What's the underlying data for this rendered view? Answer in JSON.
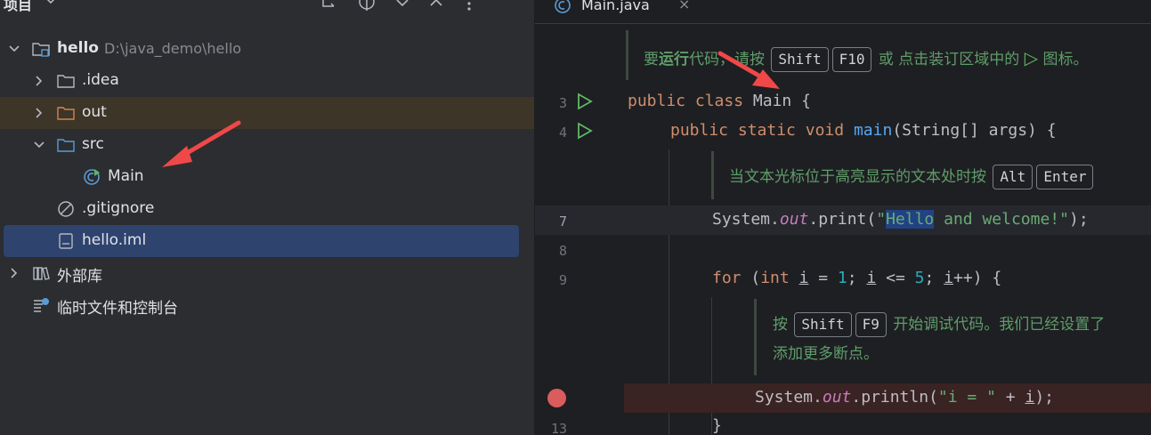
{
  "project": {
    "title": "项目",
    "tree": [
      {
        "label": "hello",
        "path": "D:\\java_demo\\hello"
      },
      {
        "label": ".idea"
      },
      {
        "label": "out"
      },
      {
        "label": "src"
      },
      {
        "label": "Main"
      },
      {
        "label": ".gitignore"
      },
      {
        "label": "hello.iml"
      },
      {
        "label": "外部库"
      },
      {
        "label": "临时文件和控制台"
      }
    ]
  },
  "editor": {
    "tab_label": "Main.java",
    "tab_close": "×",
    "line_numbers": [
      "3",
      "4",
      "7",
      "8",
      "9",
      "13"
    ],
    "doc1": {
      "prefix": "要",
      "bold": "运行",
      "mid": "代码，请按",
      "key1": "Shift",
      "key2": "F10",
      "suffix": "或 点击装订区域中的",
      "run_glyph": "▷",
      "end": "图标。"
    },
    "doc2": {
      "text": "当文本光标位于高亮显示的文本处时按",
      "key1": "Alt",
      "key2": "Enter"
    },
    "doc3": {
      "prefix": "按",
      "key1": "Shift",
      "key2": "F9",
      "suffix": "开始调试代码。我们已经设置了",
      "line2": "添加更多断点。"
    },
    "code": {
      "l3": {
        "kw1": "public",
        "kw2": "class",
        "name": "Main",
        "rest": " {"
      },
      "l4": {
        "kw1": "public",
        "kw2": "static",
        "kw3": "void",
        "fn": "main",
        "rest": "(String[] args) {"
      },
      "l7": {
        "obj": "System.",
        "fld": "out",
        "call": ".print(",
        "q": "\"",
        "sel": "Hello",
        "str": " and welcome!\"",
        "end": ");"
      },
      "l9": {
        "kw": "for",
        "p1": " (",
        "kw2": "int",
        "sp": " ",
        "v1": "i",
        "eq": " = ",
        "n1": "1",
        "sc1": "; ",
        "v2": "i",
        "le": " <= ",
        "n2": "5",
        "sc2": "; ",
        "v3": "i",
        "inc": "++) {"
      },
      "l12": {
        "obj": "System.",
        "fld": "out",
        "call": ".println(",
        "str": "\"i = \"",
        "plus": " + ",
        "v": "i",
        "end": ");"
      },
      "l13": "}"
    }
  },
  "colors": {
    "accent_selection": "#2e436e",
    "breakpoint": "#db5c5c",
    "annotation_arrow": "#f04848"
  }
}
